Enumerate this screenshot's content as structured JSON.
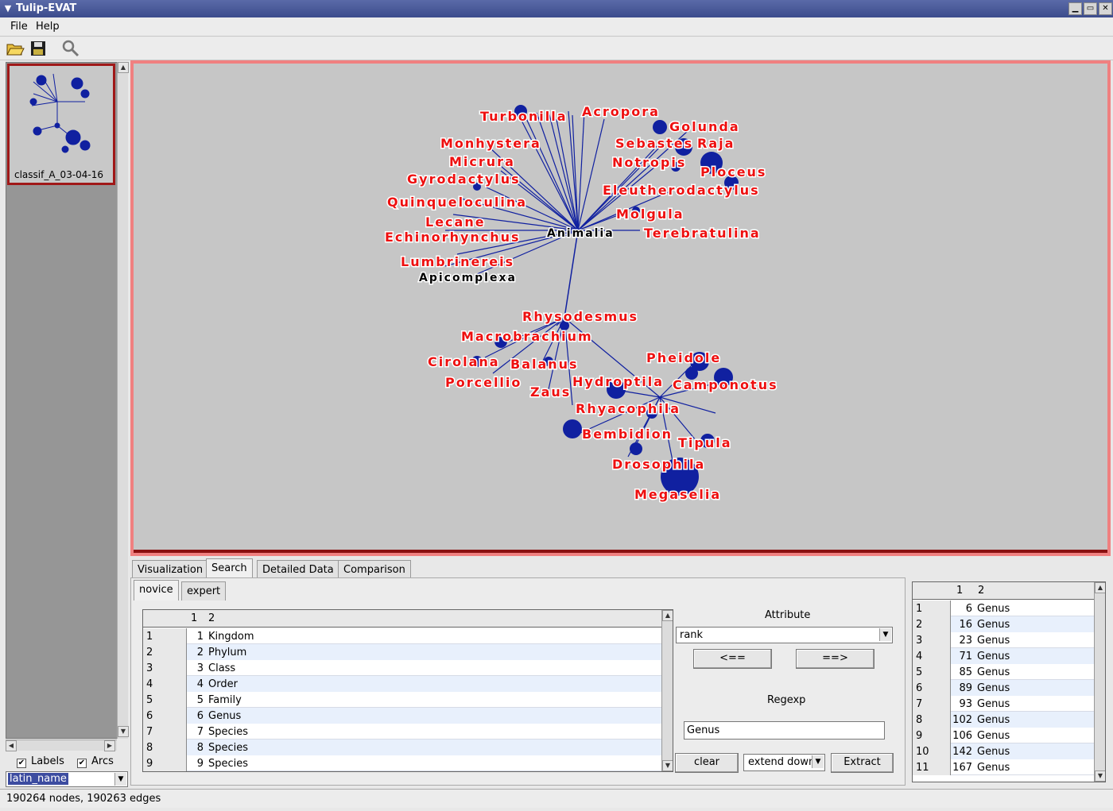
{
  "window": {
    "title": "Tulip-EVAT"
  },
  "menu": {
    "file": "File",
    "help": "Help"
  },
  "toolbar": {
    "open_icon": "folder-open-icon",
    "save_icon": "floppy-save-icon",
    "search_icon": "magnifier-icon"
  },
  "thumbnail": {
    "caption": "classif_A_03-04-16"
  },
  "left_panel": {
    "labels_checkbox": {
      "label": "Labels",
      "checked": true
    },
    "arcs_checkbox": {
      "label": "Arcs",
      "checked": true
    },
    "property_select": "latin_name"
  },
  "graph": {
    "root_label": "Animalia",
    "sub_label": "Apicomplexa",
    "labels": [
      "Turbonilla",
      "Acropora",
      "Golunda",
      "Monhystera",
      "Sebastes",
      "Raja",
      "Micrura",
      "Notropis",
      "Ploceus",
      "Gyrodactylus",
      "Eleutherodactylus",
      "Quinqueloculina",
      "Molgula",
      "Lecane",
      "Terebratulina",
      "Echinorhynchus",
      "Lumbrinereis",
      "Rhysodesmus",
      "Macrobrachium",
      "Cirolana",
      "Balanus",
      "Pheidole",
      "Porcellio",
      "Zaus",
      "Hydroptila",
      "Camponotus",
      "Rhyacophila",
      "Bembidion",
      "Tipula",
      "Drosophila",
      "Megaselia"
    ],
    "colors": {
      "label": "#ee1010",
      "edge": "#1020a0",
      "background": "#c6c6c6",
      "frame": "#f08080"
    }
  },
  "tabs": [
    "Visualization",
    "Search",
    "Detailed Data",
    "Comparison"
  ],
  "active_tab": "Search",
  "subtabs": [
    "novice",
    "expert"
  ],
  "rank_table": {
    "headers": [
      "1",
      "2"
    ],
    "rows": [
      {
        "rh": "1",
        "id": "1",
        "name": "Kingdom"
      },
      {
        "rh": "2",
        "id": "2",
        "name": "Phylum"
      },
      {
        "rh": "3",
        "id": "3",
        "name": "Class"
      },
      {
        "rh": "4",
        "id": "4",
        "name": "Order"
      },
      {
        "rh": "5",
        "id": "5",
        "name": "Family"
      },
      {
        "rh": "6",
        "id": "6",
        "name": "Genus"
      },
      {
        "rh": "7",
        "id": "7",
        "name": "Species"
      },
      {
        "rh": "8",
        "id": "8",
        "name": "Species"
      },
      {
        "rh": "9",
        "id": "9",
        "name": "Species"
      }
    ]
  },
  "search": {
    "attribute_label": "Attribute",
    "attribute_value": "rank",
    "left_button": "<==",
    "right_button": "==>",
    "regexp_label": "Regexp",
    "regexp_value": "Genus",
    "clear_button": "clear",
    "mode_value": "extend down",
    "extract_button": "Extract"
  },
  "result_table": {
    "headers": [
      "1",
      "2"
    ],
    "rows": [
      {
        "rh": "1",
        "id": "6",
        "name": "Genus"
      },
      {
        "rh": "2",
        "id": "16",
        "name": "Genus"
      },
      {
        "rh": "3",
        "id": "23",
        "name": "Genus"
      },
      {
        "rh": "4",
        "id": "71",
        "name": "Genus"
      },
      {
        "rh": "5",
        "id": "85",
        "name": "Genus"
      },
      {
        "rh": "6",
        "id": "89",
        "name": "Genus"
      },
      {
        "rh": "7",
        "id": "93",
        "name": "Genus"
      },
      {
        "rh": "8",
        "id": "102",
        "name": "Genus"
      },
      {
        "rh": "9",
        "id": "106",
        "name": "Genus"
      },
      {
        "rh": "10",
        "id": "142",
        "name": "Genus"
      },
      {
        "rh": "11",
        "id": "167",
        "name": "Genus"
      }
    ]
  },
  "status": "190264 nodes, 190263 edges"
}
